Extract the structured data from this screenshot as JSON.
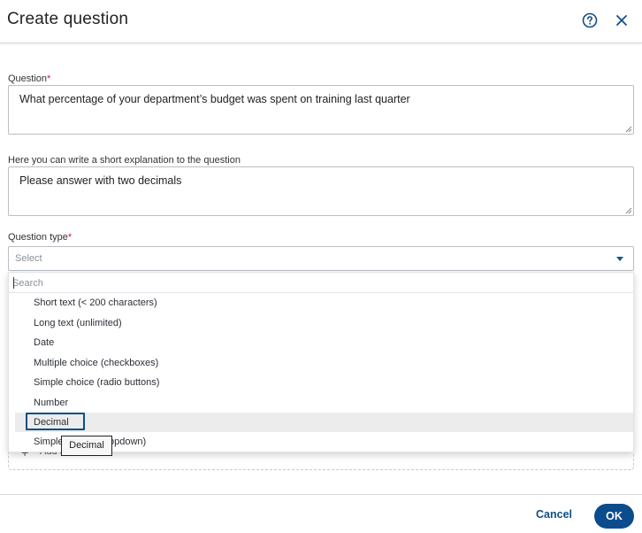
{
  "dialog": {
    "title": "Create question",
    "help_icon": "help-circle-icon",
    "close_icon": "close-icon"
  },
  "question": {
    "label": "Question",
    "required_mark": "*",
    "value": "What percentage of your department’s budget was spent on training last quarter"
  },
  "explanation": {
    "label": "Here you can write a short explanation to the question",
    "value": "Please answer with two decimals"
  },
  "question_type": {
    "label": "Question type",
    "required_mark": "*",
    "placeholder": "Select",
    "search_placeholder": "Search",
    "options": [
      "Short text (< 200 characters)",
      "Long text (unlimited)",
      "Date",
      "Multiple choice (checkboxes)",
      "Simple choice (radio buttons)",
      "Number",
      "Decimal",
      "Simple choice (dropdown)"
    ],
    "highlighted_option": "Decimal",
    "tooltip": "Decimal"
  },
  "underlying": {
    "add_label": "Add text",
    "plus_icon": "plus-icon"
  },
  "footer": {
    "cancel_label": "Cancel",
    "ok_label": "OK"
  },
  "colors": {
    "accent": "#0b4c8c",
    "required": "#d6182c",
    "highlight_row": "#ececec"
  }
}
